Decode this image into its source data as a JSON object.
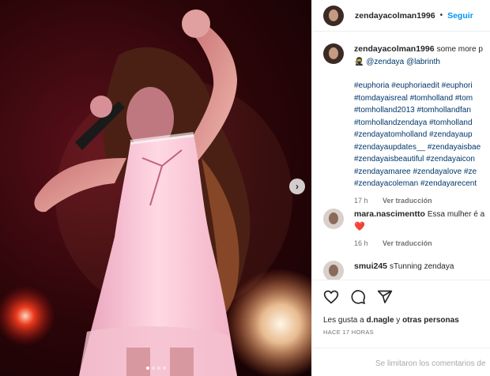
{
  "post": {
    "username": "zendayacolman1996",
    "follow_label": "Seguir",
    "separator": "•"
  },
  "caption": {
    "username": "zendayacolman1996",
    "text": "some more p",
    "emoji": "🥷",
    "mentions": "@zendaya @labrinth",
    "hashtag_lines": [
      "#euphoria #euphoriaedit #euphori",
      "#tomdayaisreal #tomholland #tom",
      "#tomholland2013 #tomhollandfan",
      "#tomhollandzendaya #tomholland",
      "#zendayatomholland #zendayaup",
      "#zendayaupdates__ #zendayaisbae",
      "#zendayaisbeautiful #zendayaicon",
      "#zendayamaree #zendayalove #ze",
      "#zendayacoleman #zendayarecent"
    ],
    "time": "17 h",
    "translate": "Ver traducción"
  },
  "comments": [
    {
      "username": "mara.nascimentto",
      "text": "Essa mulher é a",
      "emoji": "❤️",
      "time": "16 h",
      "translate": "Ver traducción"
    },
    {
      "username": "smui245",
      "text": "sTunning zendaya"
    }
  ],
  "likes": {
    "prefix": "Les gusta a",
    "user": "d.nagle",
    "middle": "y",
    "others": "otras personas"
  },
  "timestamp": "HACE 17 HORAS",
  "footer_text": "Se limitaron los comentarios de",
  "carousel": {
    "count": 4,
    "active_index": 0
  },
  "icons": [
    "heart-icon",
    "comment-icon",
    "share-icon",
    "chevron-right-icon"
  ],
  "colors": {
    "link": "#0095f6",
    "mention": "#00376b",
    "muted": "#737373"
  }
}
